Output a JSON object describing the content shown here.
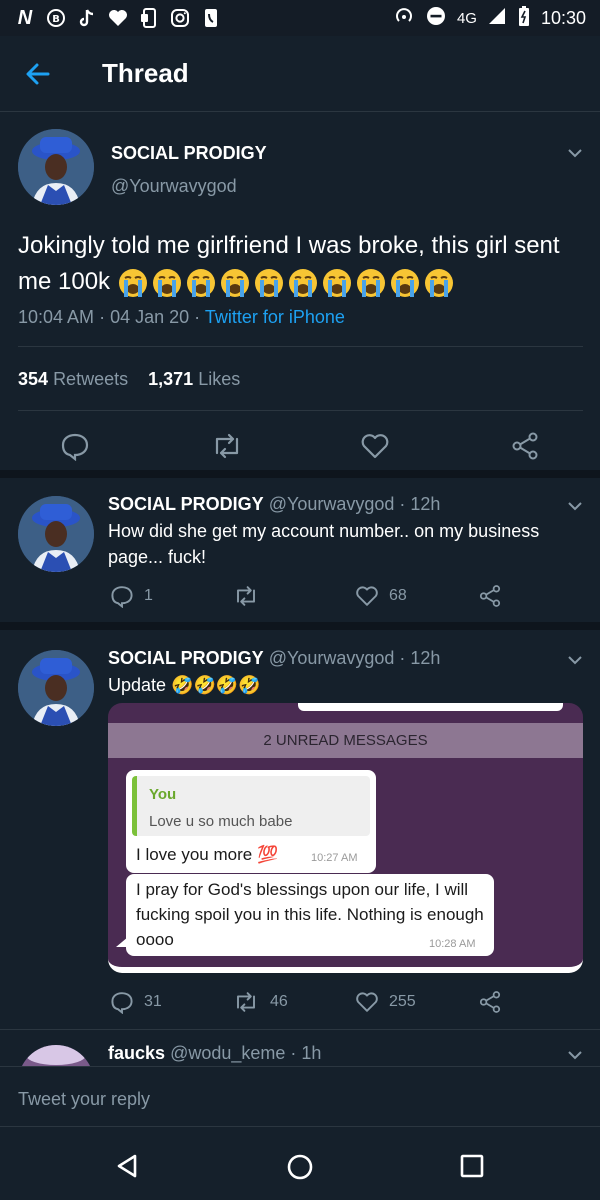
{
  "status_bar": {
    "left_icons": [
      "n-icon",
      "b-circle-icon",
      "tiktok-icon",
      "heart-icon",
      "mobile-icon",
      "instagram-icon",
      "phone-icon"
    ],
    "network": "4G",
    "time": "10:30"
  },
  "header": {
    "title": "Thread"
  },
  "main_tweet": {
    "name": "SOCIAL PRODIGY",
    "handle": "@Yourwavygod",
    "text": "Jokingly told me girlfriend I was broke, this girl sent me 100k",
    "emoji_count": 10,
    "time": "10:04 AM",
    "date": "04 Jan 20",
    "source": "Twitter for iPhone",
    "retweets": "354",
    "retweets_label": "Retweets",
    "likes": "1,371",
    "likes_label": "Likes"
  },
  "replies": [
    {
      "name": "SOCIAL PRODIGY",
      "handle": "@Yourwavygod",
      "age": "12h",
      "text": "How did she get my account number.. on my business page... fuck!",
      "reply_count": "1",
      "like_count": "68"
    },
    {
      "name": "SOCIAL PRODIGY",
      "handle": "@Yourwavygod",
      "age": "12h",
      "text": "Update 🤣🤣🤣🤣",
      "reply_count": "31",
      "retweet_count": "46",
      "like_count": "255"
    },
    {
      "name": "faucks",
      "handle": "@wodu_keme",
      "age": "1h"
    }
  ],
  "chat_image": {
    "unread_banner": "2 UNREAD MESSAGES",
    "quote_author": "You",
    "quote_text": "Love u so much babe",
    "msg1_text": "I love you more 💯",
    "msg1_time": "10:27 AM",
    "msg2_text": "I pray for God's blessings upon our life, I will fucking spoil you in this life. Nothing is enough oooo",
    "msg2_time": "10:28 AM"
  },
  "reply_bar": {
    "placeholder": "Tweet your reply"
  },
  "colors": {
    "background": "#15202b",
    "accent": "#1da1f2",
    "muted": "#8899a6",
    "chat_bg": "#4a2b52"
  }
}
